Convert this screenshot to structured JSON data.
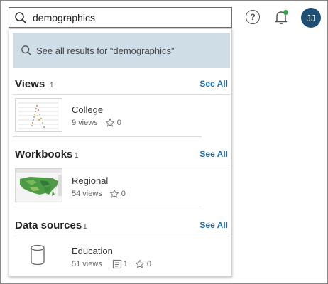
{
  "search": {
    "value": "demographics"
  },
  "header": {
    "help_label": "?",
    "avatar_initials": "JJ"
  },
  "dropdown": {
    "see_all_results": "See all results for “demographics”",
    "sections": {
      "views": {
        "title": "Views",
        "count": "1",
        "link": "See All",
        "items": [
          {
            "title": "College",
            "views": "9 views",
            "favorites": "0"
          }
        ]
      },
      "workbooks": {
        "title": "Workbooks",
        "count": "1",
        "link": "See All",
        "items": [
          {
            "title": "Regional",
            "views": "54 views",
            "favorites": "0"
          }
        ]
      },
      "data_sources": {
        "title": "Data sources",
        "count": "1",
        "link": "See All",
        "items": [
          {
            "title": "Education",
            "views": "51 views",
            "sheets": "1",
            "favorites": "0"
          }
        ]
      }
    }
  },
  "colors": {
    "accent": "#1f6ea6",
    "avatar_bg": "#1d4f74",
    "highlight_bg": "#cfdde7",
    "notification_dot": "#2ea44f"
  },
  "icons": [
    "search-icon",
    "help-icon",
    "bell-icon",
    "star-icon",
    "sheet-icon",
    "database-icon"
  ]
}
